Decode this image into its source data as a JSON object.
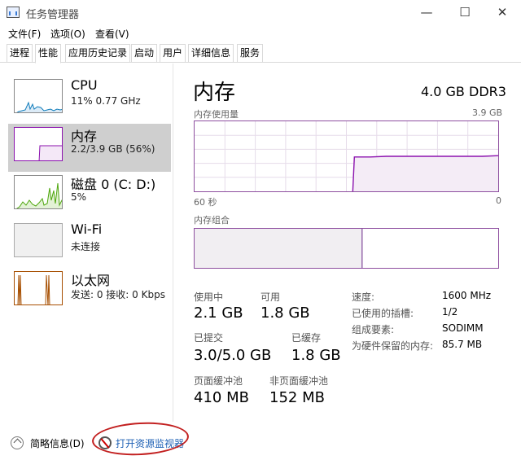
{
  "window": {
    "title": "任务管理器",
    "minimize_glyph": "—",
    "maximize_glyph": "☐",
    "close_glyph": "✕"
  },
  "menu": [
    "文件(F)",
    "选项(O)",
    "查看(V)"
  ],
  "tabs": [
    "进程",
    "性能",
    "应用历史记录",
    "启动",
    "用户",
    "详细信息",
    "服务"
  ],
  "active_tab": "性能",
  "sidebar": [
    {
      "name": "CPU",
      "detail": "11% 0.77 GHz",
      "color": "#117dbb"
    },
    {
      "name": "内存",
      "detail": "2.2/3.9 GB (56%)",
      "color": "#8b12ae"
    },
    {
      "name": "磁盘 0 (C: D:)",
      "detail": "5%",
      "color": "#4da60c"
    },
    {
      "name": "Wi-Fi",
      "detail": "未连接",
      "color": "#a5a5a5"
    },
    {
      "name": "以太网",
      "detail": "发送: 0 接收: 0 Kbps",
      "color": "#a74f01"
    }
  ],
  "selected_item": "内存",
  "main": {
    "title": "内存",
    "spec": "4.0 GB DDR3",
    "usage_caption": "内存使用量",
    "usage_max": "3.9 GB",
    "time_left": "60 秒",
    "time_right": "0",
    "composition_caption": "内存组合",
    "composition_in_use_fraction": 0.55,
    "usage_history_fraction": [
      0.0,
      0.0,
      0.0,
      0.0,
      0.0,
      0.0,
      0.0,
      0.0,
      0.0,
      0.0,
      0.49,
      0.49,
      0.5,
      0.5,
      0.5,
      0.5,
      0.5,
      0.5,
      0.5,
      0.51
    ],
    "stats": {
      "in_use_label": "使用中",
      "in_use_value": "2.1 GB",
      "available_label": "可用",
      "available_value": "1.8 GB",
      "committed_label": "已提交",
      "committed_value": "3.0/5.0 GB",
      "cached_label": "已缓存",
      "cached_value": "1.8 GB",
      "paged_pool_label": "页面缓冲池",
      "paged_pool_value": "410 MB",
      "nonpaged_pool_label": "非页面缓冲池",
      "nonpaged_pool_value": "152 MB"
    },
    "details": [
      {
        "label": "速度:",
        "value": "1600 MHz"
      },
      {
        "label": "已使用的插槽:",
        "value": "1/2"
      },
      {
        "label": "组成要素:",
        "value": "SODIMM"
      },
      {
        "label": "为硬件保留的内存:",
        "value": "85.7 MB"
      }
    ]
  },
  "footer": {
    "brief_label": "简略信息(D)",
    "monitor_link": "打开资源监视器"
  },
  "colors": {
    "memory_purple": "#8b12ae",
    "annotation_red": "#c21f1f"
  }
}
